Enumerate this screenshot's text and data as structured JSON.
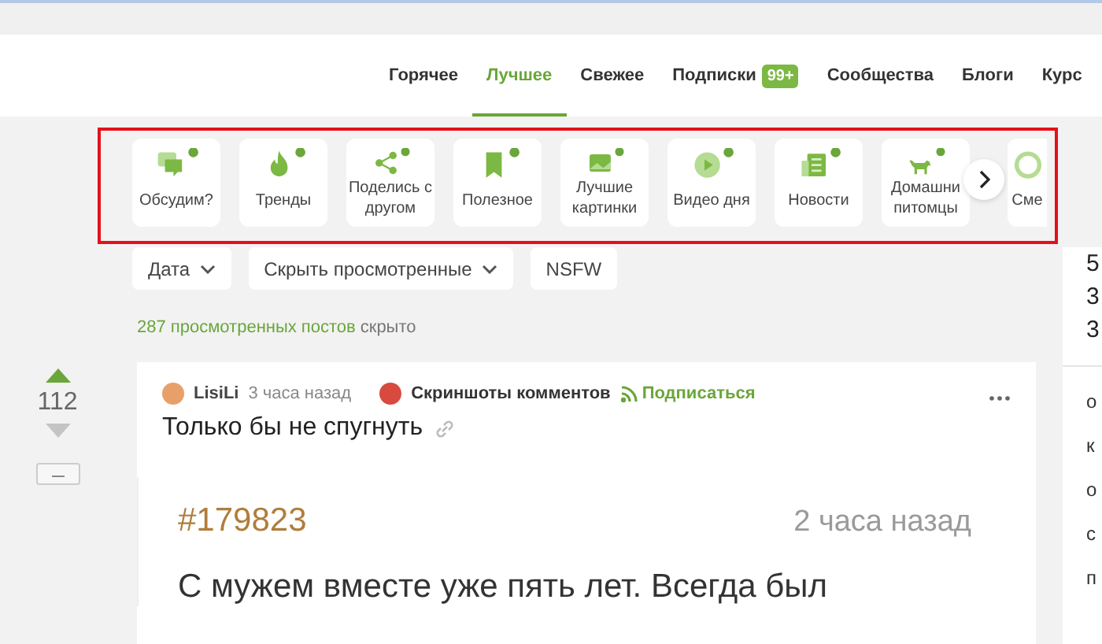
{
  "header": {
    "nav": [
      {
        "label": "Горячее",
        "selected": false
      },
      {
        "label": "Лучшее",
        "selected": true
      },
      {
        "label": "Свежее",
        "selected": false
      },
      {
        "label": "Подписки",
        "selected": false,
        "badge": "99+"
      },
      {
        "label": "Сообщества",
        "selected": false
      },
      {
        "label": "Блоги",
        "selected": false
      },
      {
        "label": "Курс",
        "selected": false
      }
    ]
  },
  "categories": [
    {
      "label": "Обсудим?",
      "kind": "chat"
    },
    {
      "label": "Тренды",
      "kind": "flame"
    },
    {
      "label": "Поделись с другом",
      "kind": "share"
    },
    {
      "label": "Полезное",
      "kind": "bookmark"
    },
    {
      "label": "Лучшие картинки",
      "kind": "image"
    },
    {
      "label": "Видео дня",
      "kind": "play"
    },
    {
      "label": "Новости",
      "kind": "news"
    },
    {
      "label": "Домашни питомцы",
      "kind": "cat"
    },
    {
      "label": "Сме",
      "kind": "partial"
    }
  ],
  "filters": [
    {
      "label": "Дата",
      "dropdown": true
    },
    {
      "label": "Скрыть просмотренные",
      "dropdown": true
    },
    {
      "label": "NSFW",
      "dropdown": false
    }
  ],
  "hidden_notice": {
    "link": "287 просмотренных постов",
    "text": "скрыто"
  },
  "post": {
    "votes": "112",
    "author": "LisiLi",
    "time": "3 часа назад",
    "community": "Скриншоты комментов",
    "subscribe": "Подписаться",
    "title": "Только бы не спугнуть",
    "quote": {
      "number": "#179823",
      "time": "2 часа назад",
      "text": "С мужем вместе уже пять лет. Всегда был"
    }
  },
  "sidebar": {
    "numbers": [
      "5",
      "3",
      "3"
    ],
    "letters": [
      "о",
      "к",
      "о",
      "с",
      "п"
    ]
  }
}
